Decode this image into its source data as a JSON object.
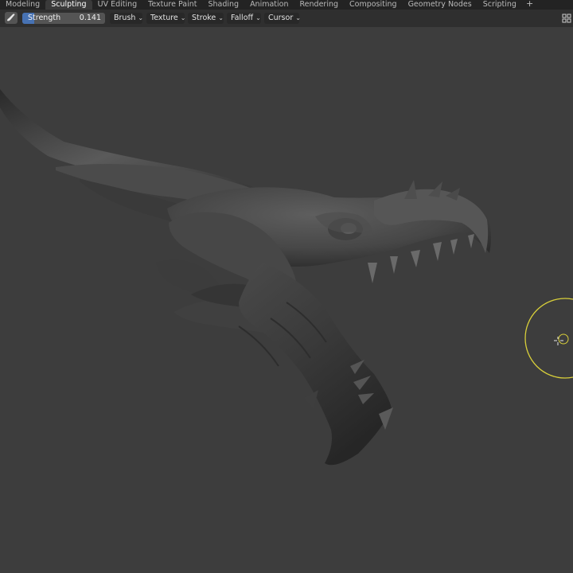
{
  "workspace_tabs": [
    {
      "label": "Modeling",
      "active": false
    },
    {
      "label": "Sculpting",
      "active": true
    },
    {
      "label": "UV Editing",
      "active": false
    },
    {
      "label": "Texture Paint",
      "active": false
    },
    {
      "label": "Shading",
      "active": false
    },
    {
      "label": "Animation",
      "active": false
    },
    {
      "label": "Rendering",
      "active": false
    },
    {
      "label": "Compositing",
      "active": false
    },
    {
      "label": "Geometry Nodes",
      "active": false
    },
    {
      "label": "Scripting",
      "active": false
    }
  ],
  "add_tab_label": "+",
  "tool_header": {
    "brush_icon": "sculpt-brush-icon",
    "strength_label": "Strength",
    "strength_value": "0.141",
    "strength_fraction": 0.141,
    "menus": [
      "Brush",
      "Texture",
      "Stroke",
      "Falloff",
      "Cursor"
    ],
    "right_icon": "grid-icon"
  },
  "colors": {
    "viewport_bg": "#3d3d3d",
    "accent": "#4772b3",
    "brush_circle": "#d8cf3a"
  },
  "viewport": {
    "object": "dragon-head-sculpt",
    "cursor_icon": "crosshair-cursor-icon"
  }
}
